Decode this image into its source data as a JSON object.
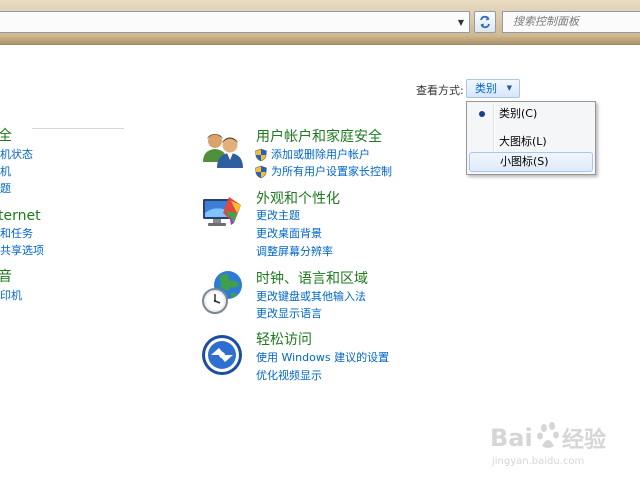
{
  "search": {
    "placeholder": "搜索控制面板"
  },
  "view_by": {
    "label": "查看方式:",
    "current": "类别",
    "options": [
      "类别(C)",
      "大图标(L)",
      "小图标(S)"
    ],
    "selected_index": 0,
    "hovered_index": 2
  },
  "left_column": {
    "items": [
      {
        "text": "全",
        "kind": "title"
      },
      {
        "text": "机状态",
        "kind": "link"
      },
      {
        "text": "机",
        "kind": "link"
      },
      {
        "text": "题",
        "kind": "link"
      },
      {
        "text": "ternet",
        "kind": "title"
      },
      {
        "text": "和任务",
        "kind": "link"
      },
      {
        "text": "共享选项",
        "kind": "link"
      },
      {
        "text": "音",
        "kind": "title"
      },
      {
        "text": "印机",
        "kind": "link"
      }
    ]
  },
  "categories": [
    {
      "icon": "user-accounts-icon",
      "title": "用户帐户和家庭安全",
      "links": [
        "添加或删除用户帐户",
        "为所有用户设置家长控制"
      ]
    },
    {
      "icon": "appearance-icon",
      "title": "外观和个性化",
      "links": [
        "更改主题",
        "更改桌面背景",
        "调整屏幕分辨率"
      ]
    },
    {
      "icon": "clock-globe-icon",
      "title": "时钟、语言和区域",
      "links": [
        "更改键盘或其他输入法",
        "更改显示语言"
      ]
    },
    {
      "icon": "ease-of-access-icon",
      "title": "轻松访问",
      "links": [
        "使用 Windows 建议的设置",
        "优化视频显示"
      ]
    }
  ],
  "watermark": {
    "brand": "Bai",
    "brand2": "经验",
    "url": "jingyan.baidu.com"
  }
}
